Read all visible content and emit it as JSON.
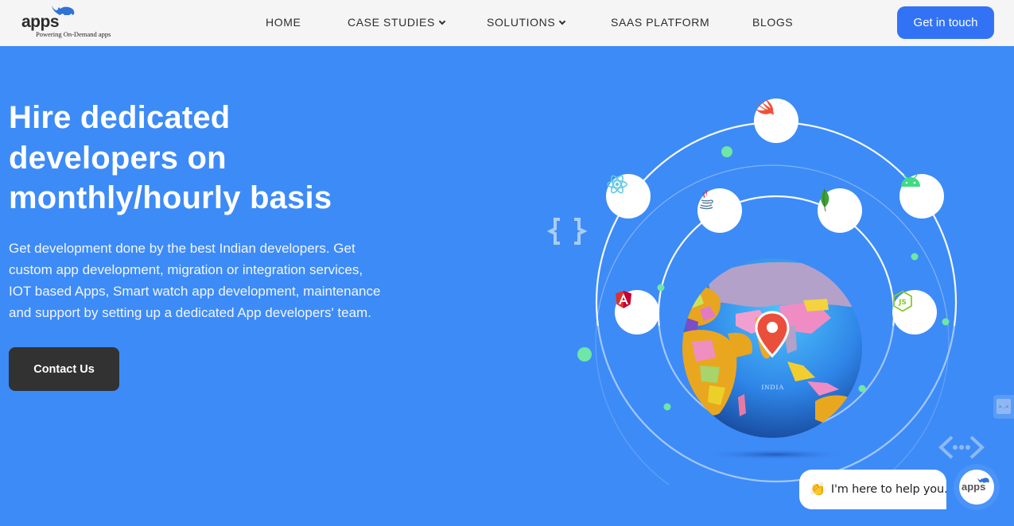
{
  "header": {
    "logo": {
      "word": "apps",
      "tagline": "Powering On-Demand apps"
    },
    "nav": [
      {
        "label": "HOME",
        "has_dropdown": false
      },
      {
        "label": "CASE STUDIES",
        "has_dropdown": true
      },
      {
        "label": "SOLUTIONS",
        "has_dropdown": true
      },
      {
        "label": "SAAS PLATFORM",
        "has_dropdown": false
      },
      {
        "label": "BLOGS",
        "has_dropdown": false
      }
    ],
    "cta_label": "Get in touch"
  },
  "hero": {
    "title_lines": [
      "Hire dedicated",
      "developers on",
      "monthly/hourly basis"
    ],
    "description_lines": [
      "Get development done by the best Indian developers. Get",
      "custom app development, migration or integration services,",
      "IOT based Apps, Smart watch app development, maintenance",
      "and support by setting up a dedicated App developers' team."
    ],
    "contact_label": "Contact Us"
  },
  "illustration": {
    "globe_label": "INDIA",
    "tech_icons": [
      "swift-icon",
      "react-icon",
      "java-icon",
      "mongodb-icon",
      "android-icon",
      "angular-icon",
      "nodejs-icon"
    ],
    "decor_icons": [
      "curly-braces-icon",
      "code-brackets-icon"
    ]
  },
  "chat": {
    "emoji": "👏",
    "message": "I'm here to help you.",
    "avatar_word": "apps"
  },
  "side_tab": {
    "glyph": ">.<"
  },
  "colors": {
    "hero_bg": "#3d8bf7",
    "header_bg": "#f5f5f5",
    "cta_bg": "#3273f6",
    "contact_bg": "#323232",
    "accent_dot": "#6ee6a6"
  }
}
